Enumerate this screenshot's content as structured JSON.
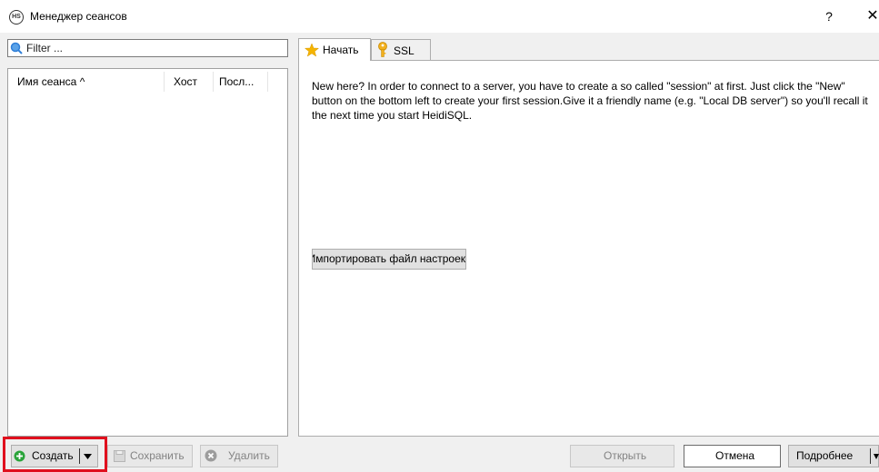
{
  "window": {
    "title": "Менеджер сеансов",
    "app_icon_text": "HS",
    "help": "?",
    "close": "✕"
  },
  "filter": {
    "placeholder": "Filter ..."
  },
  "session_list": {
    "columns": [
      "Имя сеанса ^",
      "Хост",
      "Посл..."
    ]
  },
  "tabs": [
    {
      "label": "Начать",
      "icon": "star-icon",
      "active": true
    },
    {
      "label": "SSL",
      "icon": "key-icon",
      "active": false
    }
  ],
  "start_tab": {
    "intro": "New here? In order to connect to a server, you have to create a so called \"session\" at first. Just click the \"New\" button on the bottom left to create your first session.Give it a friendly name (e.g. \"Local DB server\") so you'll recall it the next time you start HeidiSQL.",
    "import_button": "Импортировать файл настроек"
  },
  "buttons": {
    "create": "Создать",
    "save": "Сохранить",
    "delete": "Удалить",
    "open": "Открыть",
    "cancel": "Отмена",
    "more": "Подробнее"
  },
  "colors": {
    "highlight": "#e0101e",
    "create_icon": "#2aa43a",
    "star": "#f5b400",
    "key": "#e8a000",
    "search_icon": "#2f7fd8"
  }
}
